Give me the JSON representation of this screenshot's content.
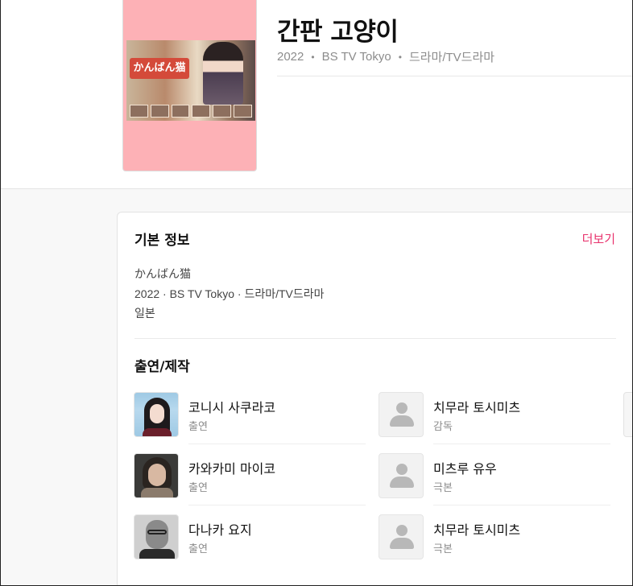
{
  "header": {
    "title": "간판 고양이",
    "meta": [
      "2022",
      "BS TV Tokyo",
      "드라마/TV드라마"
    ],
    "meta_separator": "•",
    "poster_logo": "かんばん猫"
  },
  "basic_info": {
    "section_title": "기본 정보",
    "more_label": "더보기",
    "original_title": "かんばん猫",
    "summary_line": "2022 · BS TV Tokyo · 드라마/TV드라마",
    "country": "일본"
  },
  "cast": {
    "section_title": "출연/제작",
    "left": [
      {
        "name": "코니시 사쿠라코",
        "role": "출연"
      },
      {
        "name": "카와카미 마이코",
        "role": "출연"
      },
      {
        "name": "다나카 요지",
        "role": "출연"
      }
    ],
    "right": [
      {
        "name": "치무라 토시미츠",
        "role": "감독"
      },
      {
        "name": "미츠루 유우",
        "role": "극본"
      },
      {
        "name": "치무라 토시미츠",
        "role": "극본"
      }
    ]
  },
  "colors": {
    "accent": "#e8336d",
    "poster_bg": "#fdb1b6",
    "muted_text": "#8c8c8c"
  }
}
